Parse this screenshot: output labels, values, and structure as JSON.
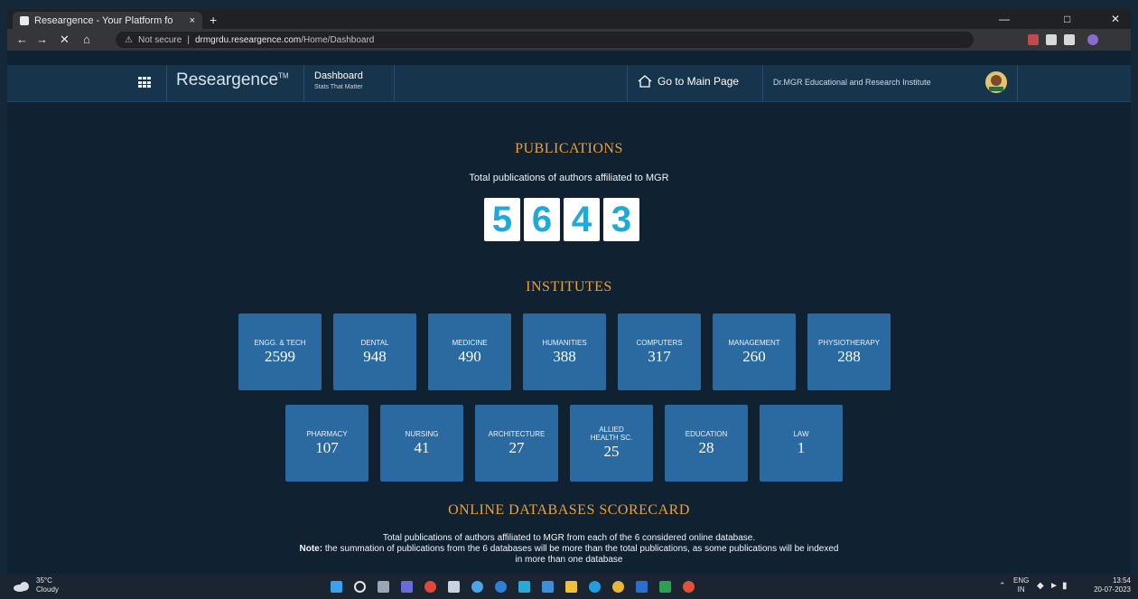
{
  "browser": {
    "tab_title": "Researgence - Your Platform fo",
    "tab_close": "×",
    "new_tab": "+",
    "url_security": "Not secure",
    "url_host": "drmgrdu.researgence.com",
    "url_path": "/Home/Dashboard"
  },
  "header": {
    "brand": "Researgence",
    "brand_mark": "TM",
    "dashboard_title": "Dashboard",
    "dashboard_subtitle": "Stats That Matter",
    "main_page_link": "Go to Main Page",
    "institute_name": "Dr.MGR Educational and Research Institute"
  },
  "publications": {
    "title": "PUBLICATIONS",
    "subtitle": "Total publications of authors affiliated to MGR",
    "digits": [
      "5",
      "6",
      "4",
      "3"
    ]
  },
  "institutes": {
    "title": "INSTITUTES",
    "row1": [
      {
        "label": "ENGG. & TECH",
        "value": "2599"
      },
      {
        "label": "DENTAL",
        "value": "948"
      },
      {
        "label": "MEDICINE",
        "value": "490"
      },
      {
        "label": "HUMANITIES",
        "value": "388"
      },
      {
        "label": "COMPUTERS",
        "value": "317"
      },
      {
        "label": "MANAGEMENT",
        "value": "260"
      },
      {
        "label": "PHYSIOTHERAPY",
        "value": "288"
      }
    ],
    "row2": [
      {
        "label": "PHARMACY",
        "value": "107"
      },
      {
        "label": "NURSING",
        "value": "41"
      },
      {
        "label": "ARCHITECTURE",
        "value": "27"
      },
      {
        "label": "ALLIED HEALTH SC.",
        "value": "25"
      },
      {
        "label": "EDUCATION",
        "value": "28"
      },
      {
        "label": "LAW",
        "value": "1"
      }
    ]
  },
  "scorecard": {
    "title": "ONLINE DATABASES SCORECARD",
    "line1": "Total publications of authors affiliated to MGR from each of the 6 considered online database.",
    "note_label": "Note:",
    "note_text": " the summation of publications from the 6 databases will be more than the total publications, as some publications will be indexed",
    "line3": "in more than one database"
  },
  "taskbar": {
    "weather_temp": "35°C",
    "weather_desc": "Cloudy",
    "lang": "ENG",
    "region": "IN",
    "time": "13:54",
    "date": "20-07-2023"
  },
  "colors": {
    "accent_title": "#e8a23c",
    "box_bg": "#2b6aa0",
    "page_bg": "#102132",
    "digit_color": "#1ea9d6"
  }
}
